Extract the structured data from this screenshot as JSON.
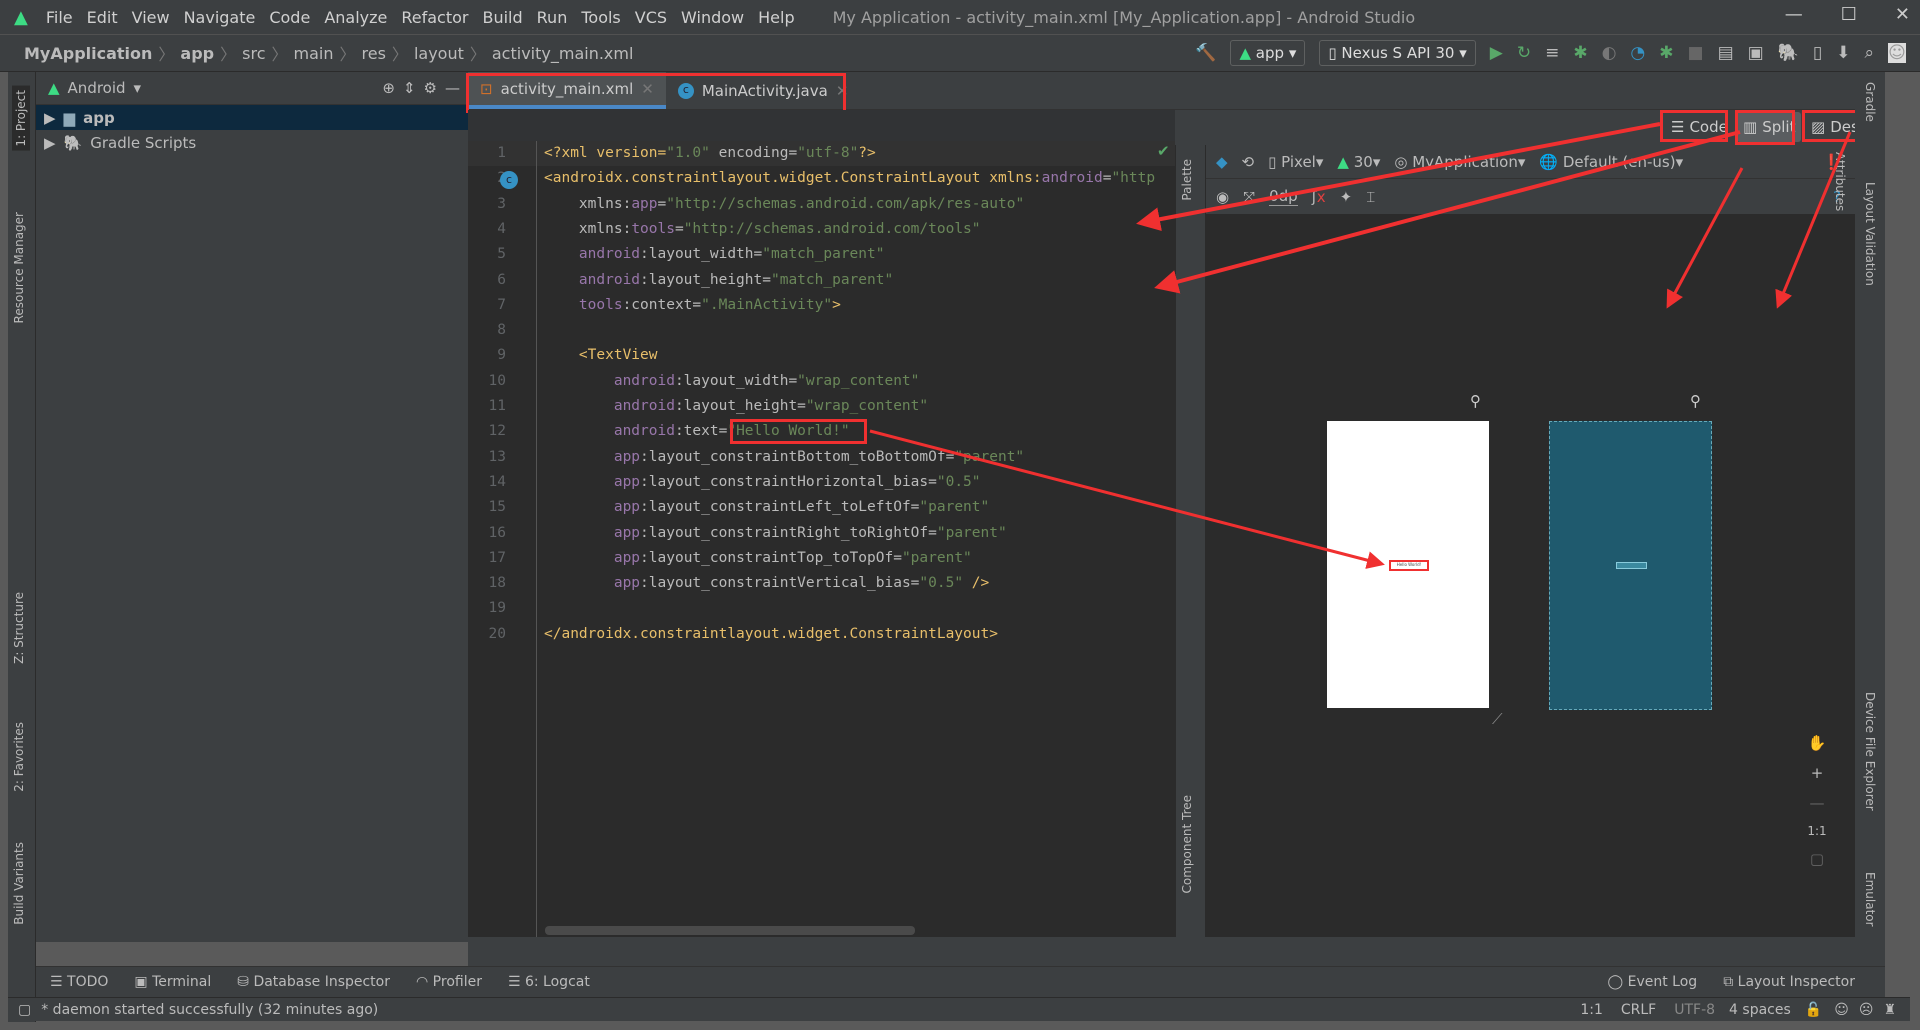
{
  "window": {
    "title": "My Application - activity_main.xml [My_Application.app] - Android Studio",
    "menu": [
      "File",
      "Edit",
      "View",
      "Navigate",
      "Code",
      "Analyze",
      "Refactor",
      "Build",
      "Run",
      "Tools",
      "VCS",
      "Window",
      "Help"
    ]
  },
  "breadcrumb": [
    "MyApplication",
    "app",
    "src",
    "main",
    "res",
    "layout",
    "activity_main.xml"
  ],
  "toolbar": {
    "run_config": "app",
    "device": "Nexus S API 30"
  },
  "project": {
    "view": "Android",
    "items": [
      "app",
      "Gradle Scripts"
    ]
  },
  "tabs": [
    {
      "label": "activity_main.xml",
      "active": true
    },
    {
      "label": "MainActivity.java",
      "active": false
    }
  ],
  "modes": {
    "code": "Code",
    "split": "Split",
    "design": "Design"
  },
  "design_toolbar": {
    "device": "Pixel",
    "api": "30",
    "theme": "MyApplication",
    "locale": "Default (en-us)",
    "margin": "0dp"
  },
  "code_lines": [
    [
      "<?xml version=",
      "\"1.0\"",
      " encoding=",
      "\"utf-8\"",
      "?>"
    ],
    [
      "<androidx.constraintlayout.widget.ConstraintLayout xmlns:",
      "android",
      "=",
      "\"http"
    ],
    [
      "    xmlns:",
      "app",
      "=",
      "\"http://schemas.android.com/apk/res-auto\""
    ],
    [
      "    xmlns:",
      "tools",
      "=",
      "\"http://schemas.android.com/tools\""
    ],
    [
      "    ",
      "android",
      ":layout_width=",
      "\"match_parent\""
    ],
    [
      "    ",
      "android",
      ":layout_height=",
      "\"match_parent\""
    ],
    [
      "    ",
      "tools",
      ":context=",
      "\".MainActivity\"",
      ">"
    ],
    [],
    [
      "    <TextView"
    ],
    [
      "        ",
      "android",
      ":layout_width=",
      "\"wrap_content\""
    ],
    [
      "        ",
      "android",
      ":layout_height=",
      "\"wrap_content\""
    ],
    [
      "        ",
      "android",
      ":text=",
      "\"Hello World!\""
    ],
    [
      "        ",
      "app",
      ":layout_constraintBottom_toBottomOf=",
      "\"parent\""
    ],
    [
      "        ",
      "app",
      ":layout_constraintHorizontal_bias=",
      "\"0.5\""
    ],
    [
      "        ",
      "app",
      ":layout_constraintLeft_toLeftOf=",
      "\"parent\""
    ],
    [
      "        ",
      "app",
      ":layout_constraintRight_toRightOf=",
      "\"parent\""
    ],
    [
      "        ",
      "app",
      ":layout_constraintTop_toTopOf=",
      "\"parent\""
    ],
    [
      "        ",
      "app",
      ":layout_constraintVertical_bias=",
      "\"0.5\"",
      " />"
    ],
    [],
    [
      "</androidx.constraintlayout.widget.ConstraintLayout>"
    ]
  ],
  "preview": {
    "text": "Hello World!",
    "blueprint_color": "#1f5a6e"
  },
  "side_tools": {
    "left": [
      "1: Project",
      "Resource Manager",
      "Z: Structure",
      "2: Favorites",
      "Build Variants"
    ],
    "right": [
      "Gradle",
      "Attributes",
      "Layout Validation",
      "Device File Explorer",
      "Emulator"
    ],
    "palette": "Palette",
    "component_tree": "Component Tree"
  },
  "bottom_tools": [
    "TODO",
    "Terminal",
    "Database Inspector",
    "Profiler",
    "6: Logcat"
  ],
  "bottom_right_tools": [
    "Event Log",
    "Layout Inspector"
  ],
  "status": {
    "message": "* daemon started successfully (32 minutes ago)",
    "position": "1:1",
    "line_sep": "CRLF",
    "encoding": "UTF-8",
    "indent": "4 spaces"
  },
  "zoom_controls": {
    "one_to_one": "1:1"
  },
  "annotation_color": "#f03030"
}
